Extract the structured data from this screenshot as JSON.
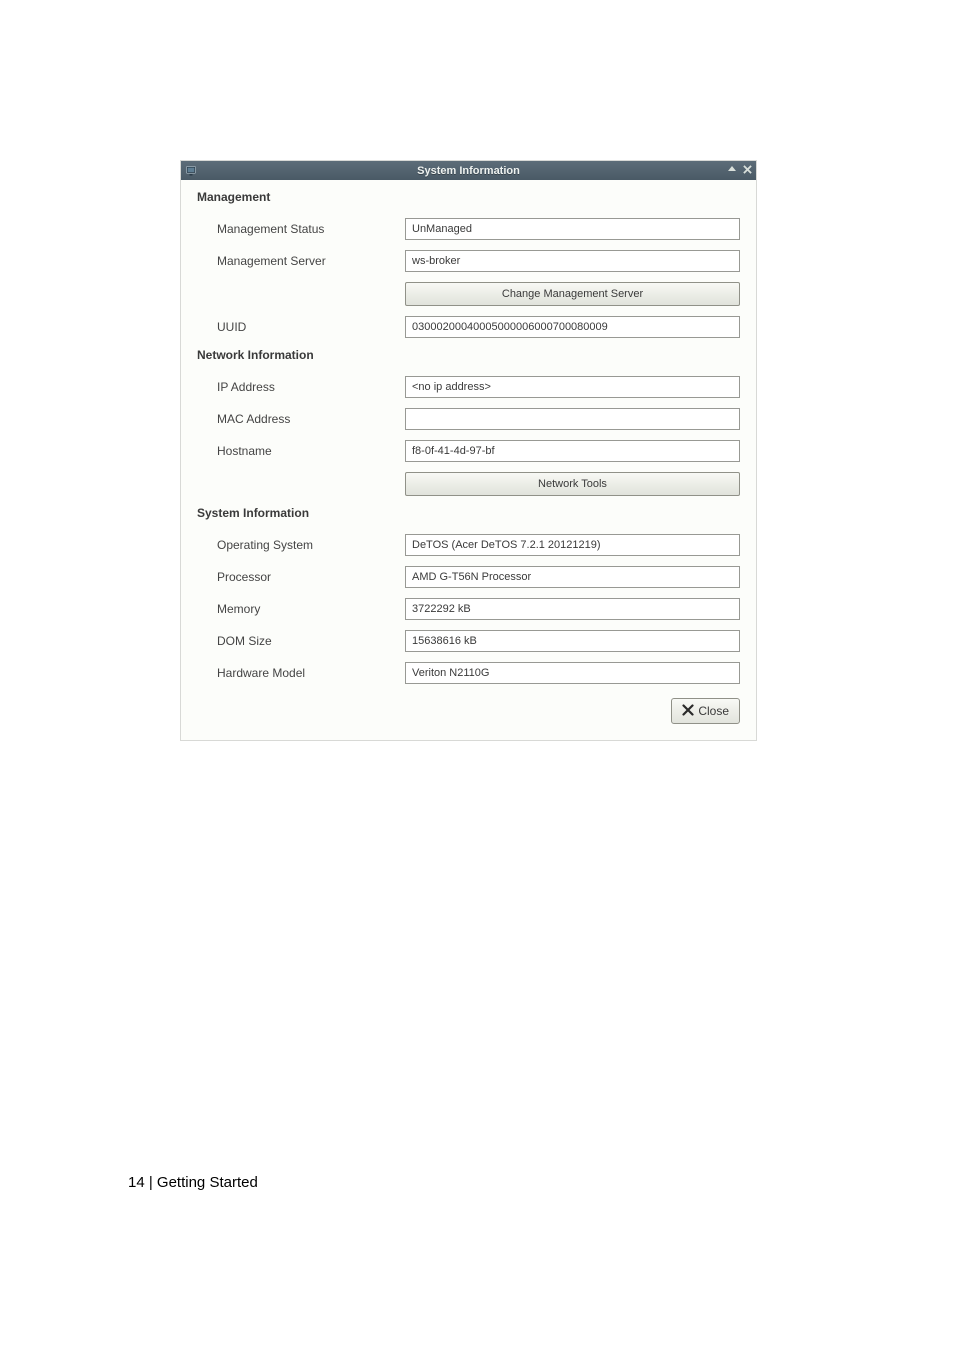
{
  "window": {
    "title": "System Information"
  },
  "sections": {
    "management": {
      "header": "Management",
      "labels": {
        "status": "Management Status",
        "server": "Management Server",
        "uuid": "UUID"
      },
      "values": {
        "status": "UnManaged",
        "server": "ws-broker",
        "uuid": "03000200040005000006000700080009"
      },
      "buttons": {
        "change_server": "Change Management Server"
      }
    },
    "network": {
      "header": "Network Information",
      "labels": {
        "ip": "IP Address",
        "mac": "MAC Address",
        "hostname": "Hostname"
      },
      "values": {
        "ip": "<no ip address>",
        "mac": "",
        "hostname": "f8-0f-41-4d-97-bf"
      },
      "buttons": {
        "tools": "Network Tools"
      }
    },
    "system": {
      "header": "System Information",
      "labels": {
        "os": "Operating System",
        "processor": "Processor",
        "memory": "Memory",
        "dom": "DOM Size",
        "hw": "Hardware Model"
      },
      "values": {
        "os": "DeTOS (Acer DeTOS 7.2.1 20121219)",
        "processor": "AMD G-T56N Processor",
        "memory": "3722292 kB",
        "dom": "15638616 kB",
        "hw": "Veriton N2110G"
      }
    }
  },
  "footer": {
    "close": "Close"
  },
  "page_footer": "14 | Getting Started"
}
